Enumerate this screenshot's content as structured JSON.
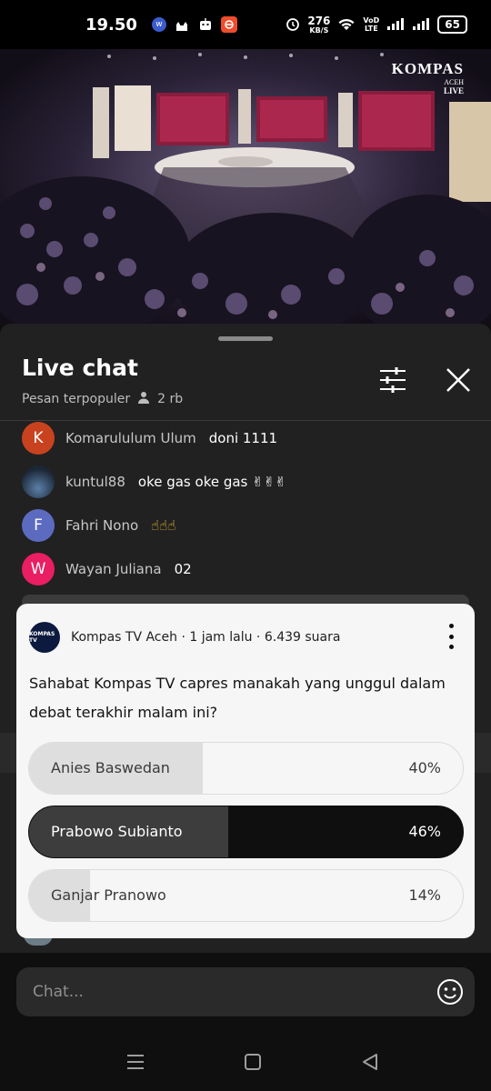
{
  "status_bar": {
    "time": "19.50",
    "network_speed_value": "276",
    "network_speed_unit": "KB/S",
    "volte_top": "VoD",
    "volte_bottom": "LTE",
    "battery": "65"
  },
  "video": {
    "channel_logo": "KOMPAS",
    "channel_region": "ACEH",
    "live_label": "LIVE"
  },
  "chat_header": {
    "title": "Live chat",
    "mode": "Pesan terpopuler",
    "viewer_count": "2 rb"
  },
  "messages": [
    {
      "author": "Komarululum Ulum",
      "text": "doni 1111",
      "avatar_letter": "K",
      "avatar_color": "#c9421f"
    },
    {
      "author": "kuntul88",
      "text": "oke gas oke gas ✌✌✌",
      "avatar_letter": "",
      "avatar_color": "#2b3d57"
    },
    {
      "author": "Fahri Nono",
      "text": "☝☝☝",
      "avatar_letter": "F",
      "avatar_color": "#5c6bc0"
    },
    {
      "author": "Wayan Juliana",
      "text": "02",
      "avatar_letter": "W",
      "avatar_color": "#e91e63"
    }
  ],
  "poll": {
    "channel_avatar_text": "KOMPAS TV",
    "meta": "Kompas TV Aceh · 1 jam lalu · 6.439 suara",
    "question": "Sahabat Kompas TV capres manakah yang unggul dalam debat terakhir malam ini?",
    "options": [
      {
        "label": "Anies Baswedan",
        "percent_label": "40%",
        "percent": 40,
        "selected": false
      },
      {
        "label": "Prabowo Subianto",
        "percent_label": "46%",
        "percent": 46,
        "selected": true
      },
      {
        "label": "Ganjar Pranowo",
        "percent_label": "14%",
        "percent": 14,
        "selected": false
      }
    ]
  },
  "input": {
    "placeholder": "Chat..."
  },
  "icons": {
    "tune": "tune-icon",
    "close": "close-icon",
    "person": "person-icon",
    "emoji": "emoji-icon",
    "more": "more-vert-icon"
  }
}
